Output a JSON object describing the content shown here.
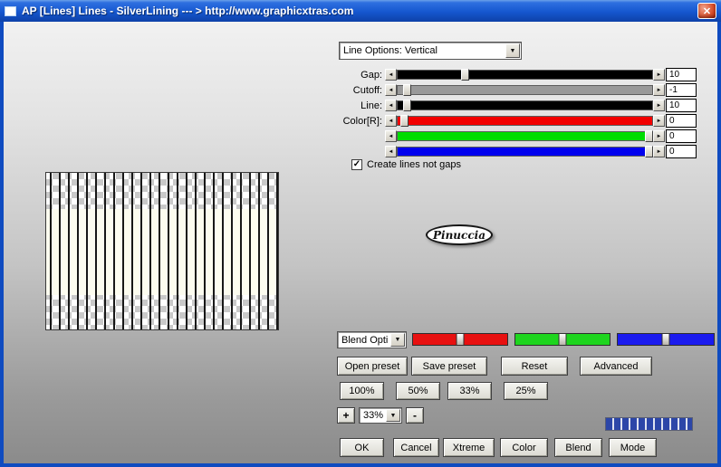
{
  "window": {
    "title": "AP [Lines]  Lines - SilverLining   --- > http://www.graphicxtras.com"
  },
  "icons": {
    "close": "✕",
    "dropdown": "▼",
    "check": "✓",
    "arrow_left": "◄",
    "arrow_right": "►"
  },
  "panel": {
    "line_options_value": "Line Options: Vertical",
    "sliders": [
      {
        "label": "Gap:",
        "value": "10"
      },
      {
        "label": "Cutoff:",
        "value": "-1"
      },
      {
        "label": "Line:",
        "value": "10"
      },
      {
        "label": "Color[R]:",
        "value": "0"
      },
      {
        "label": "",
        "value": "0"
      },
      {
        "label": "",
        "value": "0"
      }
    ],
    "checkbox_label": "Create lines not gaps",
    "checkbox_checked": true,
    "badge_text": "Pinuccia",
    "blend_dropdown_value": "Blend Opti",
    "preset_buttons": [
      "Open preset",
      "Save preset",
      "Reset",
      "Advanced"
    ],
    "zoom_preset_buttons": [
      "100%",
      "50%",
      "33%",
      "25%"
    ],
    "zoom_controls": {
      "plus": "+",
      "value": "33%",
      "minus": "-"
    },
    "bottom_buttons": [
      "OK",
      "Cancel",
      "Xtreme",
      "Color",
      "Blend",
      "Mode"
    ]
  },
  "colors": {
    "titlebar_blue": "#1557cf",
    "slider_tracks": [
      "#000000",
      "#999999",
      "#000000",
      "#f20000",
      "#00dd00",
      "#0000ee"
    ],
    "slider_thumb_pos": [
      25,
      2,
      2,
      1,
      97,
      97
    ],
    "blend_sliders": [
      "#e81010",
      "#1ed51e",
      "#1a1aee"
    ],
    "progress_blue": "#2c46a8"
  }
}
